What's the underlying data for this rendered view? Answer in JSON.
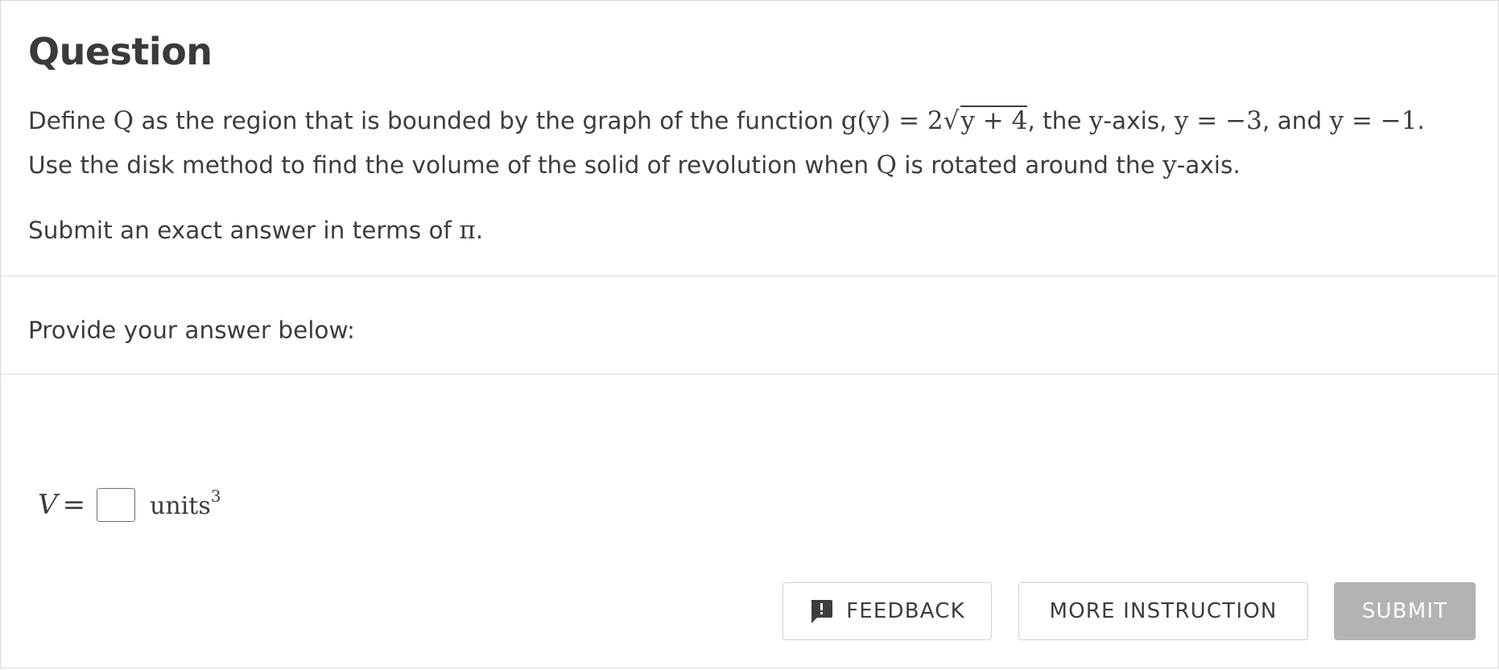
{
  "question": {
    "title": "Question",
    "line1": {
      "t1": "Define ",
      "m1": "Q",
      "t2": " as the region that is bounded by the graph of the function ",
      "m2_prefix": "g(y) = 2√",
      "m2_radicand": "y + 4",
      "t3": ", the ",
      "m3": "y",
      "t4": "-axis, ",
      "m4": "y = −3",
      "t5": ", and ",
      "m5": "y = −1",
      "t6": "."
    },
    "line2": {
      "t1": "Use the disk method to find the volume of the solid of revolution when ",
      "m1": "Q",
      "t2": " is rotated around the ",
      "m2": "y",
      "t3": "-axis."
    },
    "line3": {
      "t1": "Submit an exact answer in terms of ",
      "m1": "π",
      "t2": "."
    }
  },
  "answer": {
    "header": "Provide your answer below:",
    "variable": "V",
    "equals": "=",
    "input_value": "",
    "units": "units",
    "units_exponent": "3"
  },
  "buttons": {
    "feedback": "FEEDBACK",
    "more_instruction": "MORE INSTRUCTION",
    "submit": "SUBMIT"
  },
  "icons": {
    "feedback": "feedback-speech-bubble-icon"
  },
  "colors": {
    "text": "#3d3d3d",
    "border": "#d9d9d9",
    "submit_bg": "#b3b3b3",
    "submit_text": "#ffffff"
  }
}
